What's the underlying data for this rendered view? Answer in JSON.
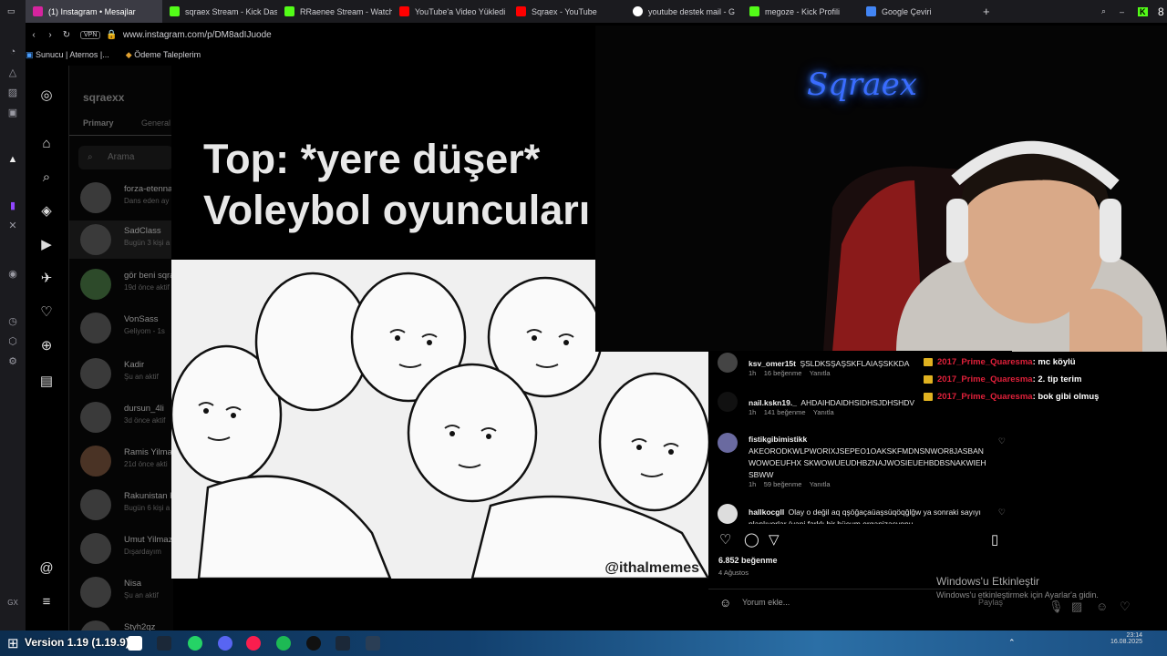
{
  "browser": {
    "tabs": [
      {
        "label": "(1) Instagram • Mesajlar",
        "active": true,
        "color": "#d6249f"
      },
      {
        "label": "sqraex Stream - Kick Das",
        "color": "#53fc18"
      },
      {
        "label": "RRaenee Stream - Watch",
        "color": "#53fc18"
      },
      {
        "label": "YouTube'a Video Yükledi",
        "color": "#ff0000"
      },
      {
        "label": "Sqraex - YouTube",
        "color": "#ff0000"
      },
      {
        "label": "youtube destek mail - G",
        "color": "#ffffff"
      },
      {
        "label": "megoze - Kick Profili",
        "color": "#53fc18"
      },
      {
        "label": "Google Çeviri",
        "color": "#4285f4"
      }
    ],
    "url": "www.instagram.com/p/DM8adIJuode",
    "vpn": "VPN",
    "bookmarks": [
      "Sunucu | Aternos |...",
      "Ödeme Taleplerim"
    ],
    "kick_count": "8"
  },
  "ig": {
    "username": "sqraexx",
    "tabs": [
      "Primary",
      "General"
    ],
    "search_placeholder": "Arama",
    "dms": [
      {
        "name": "forza-etenna",
        "sub": "Dans eden ay"
      },
      {
        "name": "SadClass",
        "sub": "Bugün 3 kişi a"
      },
      {
        "name": "gör beni sqra",
        "sub": "19d önce aktif"
      },
      {
        "name": "VonSass",
        "sub": "Geliyom - 1s"
      },
      {
        "name": "Kadir",
        "sub": "Şu an aktif"
      },
      {
        "name": "dursun_4li",
        "sub": "3d önce aktif"
      },
      {
        "name": "Ramis Yilmaz",
        "sub": "21d önce akti"
      },
      {
        "name": "Rakunistan K",
        "sub": "Bugün 6 kişi a"
      },
      {
        "name": "Umut Yilmaz",
        "sub": "Dışardayım"
      },
      {
        "name": "Nisa",
        "sub": "Şu an aktif"
      },
      {
        "name": "Styh2qz",
        "sub": ""
      }
    ]
  },
  "post": {
    "caption_line1": "Top: *yere düşer*",
    "caption_line2": "Voleybol oyuncuları",
    "watermark": "@ithalmemes",
    "likes": "6.852 beğenme",
    "date": "4 Ağustos",
    "comment_placeholder": "Yorum ekle...",
    "share_label": "Paylaş",
    "comments": [
      {
        "user": "ksv_omer15t",
        "text": "ŞSLDKSŞAŞSKFLAIAŞSKKDA",
        "time": "1h",
        "likes": "16 beğenme",
        "reply": "Yanıtla"
      },
      {
        "user": "nail.kskn19._",
        "text": "AHDAIHDAIDHSIDHSJDHSHDV",
        "time": "1h",
        "likes": "141 beğenme",
        "reply": "Yanıtla"
      },
      {
        "user": "fistikgibimistikk",
        "text": "AKEORODKWLPWORIXJSEPEO1OAKSKFMDNSNWOR8JASBANWOWOEUFHX SKWOWUEUDHBZNAJWOSIEUEHBDBSNAKWIEHSBWW",
        "time": "1h",
        "likes": "59 beğenme",
        "reply": "Yanıtla"
      },
      {
        "user": "hallkocgll",
        "text": "Olay o değil aq qşöğaçaüaşsüqöqğlğw ya sonraki sayıyı planlıyorlar (yani farklı bir hücum organizasyonu",
        "time": "",
        "likes": "",
        "reply": ""
      }
    ]
  },
  "stream": {
    "neon_text": "Sqraex",
    "chat": [
      {
        "user": "2017_Prime_Quaresma",
        "msg": ": mc köylü"
      },
      {
        "user": "2017_Prime_Quaresma",
        "msg": ": 2. tip terim"
      },
      {
        "user": "2017_Prime_Quaresma",
        "msg": ": bok gibi olmuş"
      }
    ]
  },
  "windows": {
    "activate_title": "Windows'u Etkinleştir",
    "activate_sub": "Windows'u etkinleştirmek için Ayarlar'a gidin.",
    "taskbar_text": "Version 1.19 (1.19.9)",
    "clock_time": "23:14",
    "clock_date": "16.08.2025"
  },
  "colors": {
    "chat_user": "#e0203a",
    "neon": "#3a6cff"
  }
}
